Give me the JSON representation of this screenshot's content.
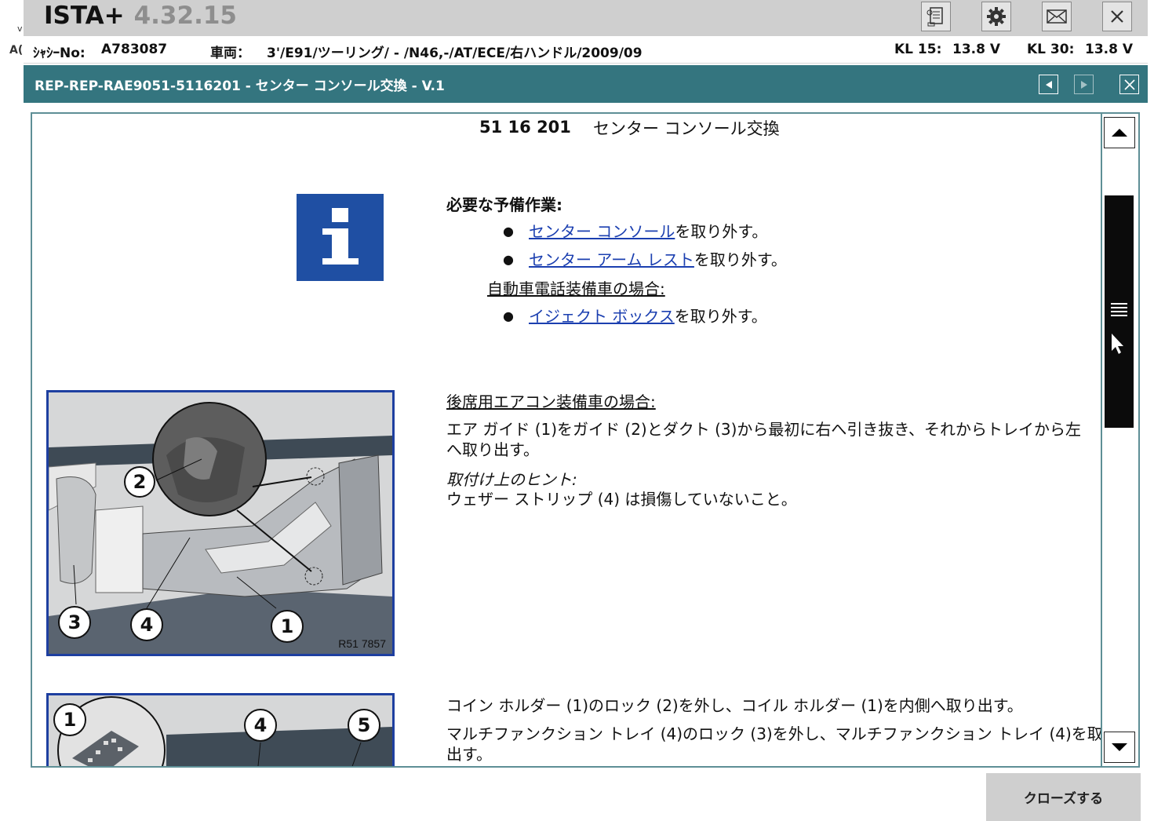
{
  "app": {
    "title": "ISTA+",
    "version": "4.32.15"
  },
  "toolbar": {
    "icons": [
      "document-icon",
      "gear-icon",
      "mail-icon",
      "close-icon"
    ]
  },
  "vehicle": {
    "chassis_label": "ｼｬｼｰNo:",
    "chassis_value": "A783087",
    "vehicle_label": "車両：",
    "vehicle_value": "3'/E91/ツーリング/ - /N46,-/AT/ECE/右ハンドル/2009/09",
    "kl15_label": "KL 15:",
    "kl15_value": "13.8 V",
    "kl30_label": "KL 30:",
    "kl30_value": "13.8 V"
  },
  "document": {
    "title": "REP-REP-RAE9051-5116201 - センター コンソール交換 - V.1",
    "number": "51 16 201",
    "heading": "センター コンソール交換"
  },
  "prerequisites": {
    "title": "必要な予備作業:",
    "items": [
      {
        "link": "センター コンソール",
        "suffix": "を取り外す。"
      },
      {
        "link": "センター アーム レスト",
        "suffix": "を取り外す。"
      }
    ],
    "condition": "自動車電話装備車の場合:",
    "condition_items": [
      {
        "link": "イジェクト ボックス",
        "suffix": "を取り外す。"
      }
    ]
  },
  "step1": {
    "condition": "後席用エアコン装備車の場合:",
    "text_line1": "エア ガイド (1)をガイド (2)とダクト (3)から最初に右へ引き抜き、それからトレイから左",
    "text_line2": "へ取り出す。",
    "hint_title": "取付け上のヒント:",
    "hint_text": "ウェザー ストリップ (4) は損傷していないこと。",
    "figure_label": "R51 7857",
    "callouts": [
      "1",
      "2",
      "3",
      "4"
    ]
  },
  "step2": {
    "text_line1": "コイン ホルダー (1)のロック (2)を外し、コイル ホルダー (1)を内側へ取り出す。",
    "text_line2": "マルチファンクション トレイ (4)のロック (3)を外し、マルチファンクション トレイ (4)を取り",
    "text_line3": "出す。",
    "callouts": [
      "1",
      "4",
      "5"
    ]
  },
  "footer": {
    "close_label": "クローズする"
  },
  "colors": {
    "doc_bar": "#34757f",
    "info_icon": "#1f4fa3",
    "link": "#1b3fb0",
    "figure_border": "#1e3fa0"
  }
}
